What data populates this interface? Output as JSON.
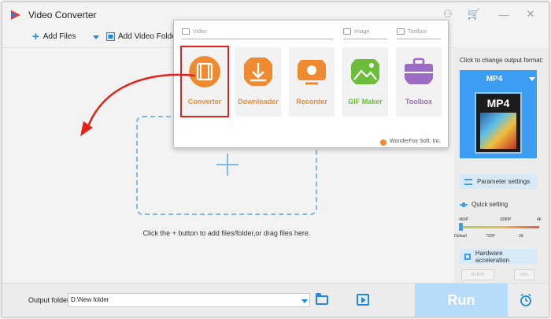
{
  "window": {
    "title": "Video Converter"
  },
  "toolbar": {
    "add_files": "Add Files",
    "add_video_folder": "Add Video Folder"
  },
  "main": {
    "hint": "Click the + button to add files/folder,or drag files here."
  },
  "popup": {
    "categories": {
      "video": "Video",
      "image": "Image",
      "toolbox": "Toolbox"
    },
    "tools": [
      {
        "label": "Converter",
        "color": "#f08a30"
      },
      {
        "label": "Downloader",
        "color": "#f08a30"
      },
      {
        "label": "Recorder",
        "color": "#f08a30"
      },
      {
        "label": "GIF Maker",
        "color": "#6cbd3a"
      },
      {
        "label": "Toolbox",
        "color": "#9c6cc4"
      }
    ],
    "footer": "WonderFox Soft, Inc."
  },
  "right_panel": {
    "change_format_label": "Click to change output format:",
    "format": "MP4",
    "thumb_label": "MP4",
    "parameter_settings": "Parameter settings",
    "quick_setting": "Quick setting",
    "ticks_top": [
      "480P",
      "1080P",
      "4K"
    ],
    "ticks_bottom": [
      "Default",
      "720P",
      "2K"
    ],
    "quality_level": 0,
    "hardware_acceleration": "Hardware acceleration",
    "gpu_chips": [
      "NVIDIA",
      "Intel"
    ]
  },
  "bottom": {
    "output_folder_label": "Output folder:",
    "output_folder_value": "D:\\New folder",
    "run": "Run"
  },
  "colors": {
    "accent": "#1e88e5",
    "highlight": "#e2231a"
  }
}
